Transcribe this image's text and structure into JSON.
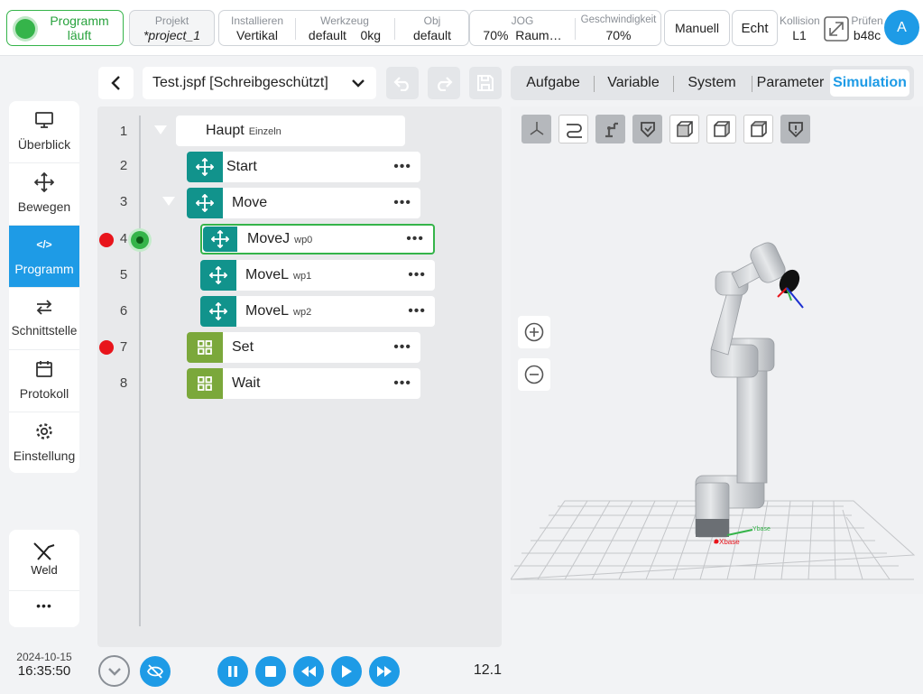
{
  "topbar": {
    "status": {
      "line1": "Programm",
      "line2": "läuft"
    },
    "project": {
      "label": "Projekt",
      "value": "*project_1"
    },
    "install": {
      "label": "Installieren",
      "value": "Vertikal"
    },
    "tool": {
      "label": "Werkzeug",
      "value": "default",
      "value2": "0kg"
    },
    "obj": {
      "label": "Obj",
      "value": "default"
    },
    "jog": {
      "label": "JOG",
      "value": "70%",
      "value2": "Raum…"
    },
    "speed": {
      "label": "Geschwindigkeit",
      "value": "70%"
    },
    "mode_button": "Manuell",
    "real_button": "Echt",
    "collision": {
      "label": "Kollision",
      "value": "L1"
    },
    "check": {
      "label": "Prüfen",
      "value": "b48c"
    },
    "avatar": "A"
  },
  "sidebar": {
    "items": [
      {
        "label": "Überblick",
        "icon": "monitor-icon"
      },
      {
        "label": "Bewegen",
        "icon": "move-icon"
      },
      {
        "label": "Programm",
        "icon": "code-icon"
      },
      {
        "label": "Schnittstelle",
        "icon": "swap-icon"
      },
      {
        "label": "Protokoll",
        "icon": "calendar-icon"
      },
      {
        "label": "Einstellung",
        "icon": "gear-icon"
      }
    ],
    "weld": "Weld",
    "more": "•••"
  },
  "datetime": {
    "date": "2024-10-15",
    "time": "16:35:50"
  },
  "editor": {
    "file_title": "Test.jspf [Schreibgeschützt]",
    "lines": [
      {
        "num": "1",
        "name": "Haupt",
        "sub": "Einzeln",
        "more": ""
      },
      {
        "num": "2",
        "name": "Start",
        "sub": "",
        "more": "•••"
      },
      {
        "num": "3",
        "name": "Move",
        "sub": "",
        "more": "•••"
      },
      {
        "num": "4",
        "name": "MoveJ",
        "sub": "wp0",
        "more": "•••"
      },
      {
        "num": "5",
        "name": "MoveL",
        "sub": "wp1",
        "more": "•••"
      },
      {
        "num": "6",
        "name": "MoveL",
        "sub": "wp2",
        "more": "•••"
      },
      {
        "num": "7",
        "name": "Set",
        "sub": "",
        "more": "•••"
      },
      {
        "num": "8",
        "name": "Wait",
        "sub": "",
        "more": "•••"
      }
    ]
  },
  "tabs": [
    "Aufgabe",
    "Variable",
    "System",
    "Parameter",
    "Simulation"
  ],
  "scene": {
    "axis_x": "Xbase",
    "axis_y": "Ybase"
  },
  "controls": {
    "speed_value": "12.1"
  },
  "colors": {
    "accent": "#1e9be6",
    "running": "#35b44a",
    "teal": "#11938c",
    "olive": "#7ba83b",
    "breakpoint": "#e8141b"
  }
}
